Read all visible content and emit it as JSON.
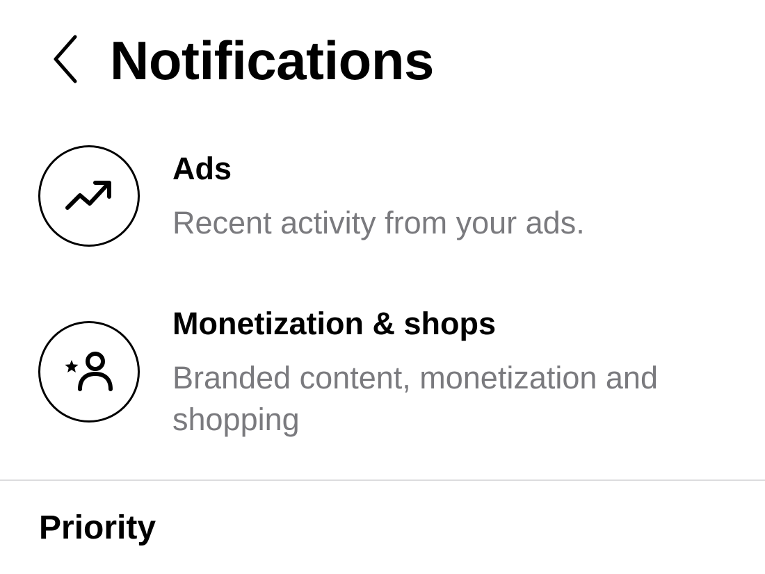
{
  "header": {
    "title": "Notifications",
    "back_icon": "chevron-left-icon"
  },
  "items": [
    {
      "title": "Ads",
      "description": "Recent activity from your ads.",
      "icon": "trending-up-icon"
    },
    {
      "title": "Monetization & shops",
      "description": "Branded content, monetization and shopping",
      "icon": "star-person-icon"
    }
  ],
  "sections": {
    "priority_title": "Priority"
  },
  "colors": {
    "text_primary": "#000000",
    "text_secondary": "#7a7a7e",
    "divider": "#dcdcde",
    "background": "#ffffff"
  }
}
